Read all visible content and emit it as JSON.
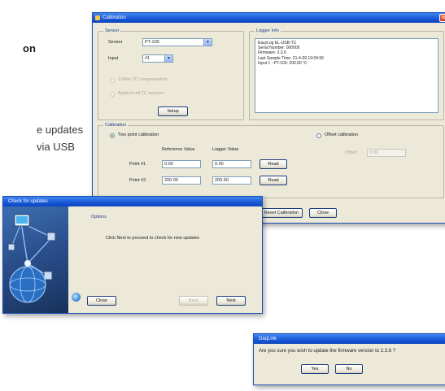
{
  "page_text": {
    "heading_fragment": "on",
    "line1": "e updates",
    "line2": "via USB"
  },
  "calibration_window": {
    "title": "Calibration",
    "sensor_group": {
      "label": "Sensor",
      "sensor_label": "Sensor",
      "sensor_value": "PT-100",
      "input_label": "Input",
      "input_value": "#1",
      "option1": "2-Wire TC compensation",
      "option2": "Apply to all TC sensors",
      "setup_button": "Setup"
    },
    "logger_info": {
      "label": "Logger Info",
      "lines": [
        "EasyLog EL-USB-TC",
        "Serial Number: 000000",
        "Firmware: 2.3.6",
        "Last Sample Time: 21-4-09 10:04:56",
        "Input 1 : PT-100: 200.50 °C"
      ]
    },
    "calibration_group": {
      "label": "Calibration",
      "two_point_label": "Two point calibration",
      "offset_label": "Offset calibration",
      "reference_header": "Reference Value",
      "logger_header": "Logger Value",
      "point1_label": "Point #1",
      "point1_reference": "0.00",
      "point1_logger": "0.00",
      "point1_button": "Read",
      "point2_label": "Point #2",
      "point2_reference": "200.00",
      "point2_logger": "200.50",
      "point2_button": "Read",
      "offset_field_label": "Offset",
      "offset_value": "0.00"
    },
    "reset_button": "Reset Calibration",
    "close_button": "Close"
  },
  "update_window": {
    "title": "Check for updates",
    "section_label": "Options",
    "instruction": "Click Next to proceed to check for new updates",
    "close_button": "Close",
    "back_button": "Back",
    "next_button": "Next"
  },
  "confirm_dialog": {
    "title": "DaqLink",
    "message": "Are you sure you wish to update the firmware version to 2.3.6 ?",
    "yes_button": "Yes",
    "no_button": "No"
  },
  "colors": {
    "titlebar": "#1756d6",
    "window_bg": "#ece9d8",
    "page_text": "#3a3a3a"
  }
}
